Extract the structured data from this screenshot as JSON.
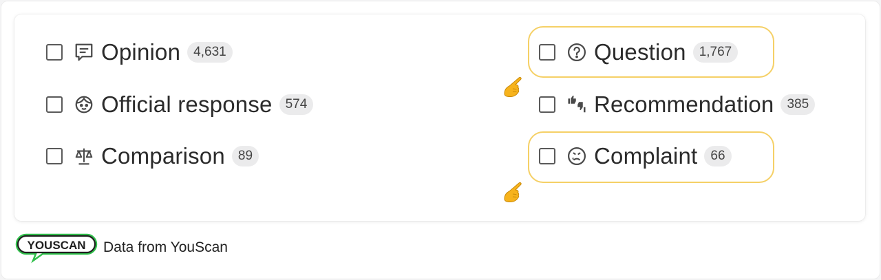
{
  "categories": [
    {
      "label": "Opinion",
      "count": "4,631",
      "icon": "speech-bubble-lines-icon"
    },
    {
      "label": "Official response",
      "count": "574",
      "icon": "face-icon"
    },
    {
      "label": "Comparison",
      "count": "89",
      "icon": "balance-scale-icon"
    },
    {
      "label": "Question",
      "count": "1,767",
      "icon": "question-circle-icon",
      "highlighted": true
    },
    {
      "label": "Recommendation",
      "count": "385",
      "icon": "thumbs-up-down-icon"
    },
    {
      "label": "Complaint",
      "count": "66",
      "icon": "sad-face-icon",
      "highlighted": true
    }
  ],
  "footer": {
    "logo_text": "YOUSCAN",
    "source_text": "Data from YouScan"
  },
  "colors": {
    "highlight": "#f5d066",
    "logo_green": "#2fbf4a",
    "hand_yellow": "#f7b31c"
  },
  "pointer_icon": "pointing-hand-icon"
}
